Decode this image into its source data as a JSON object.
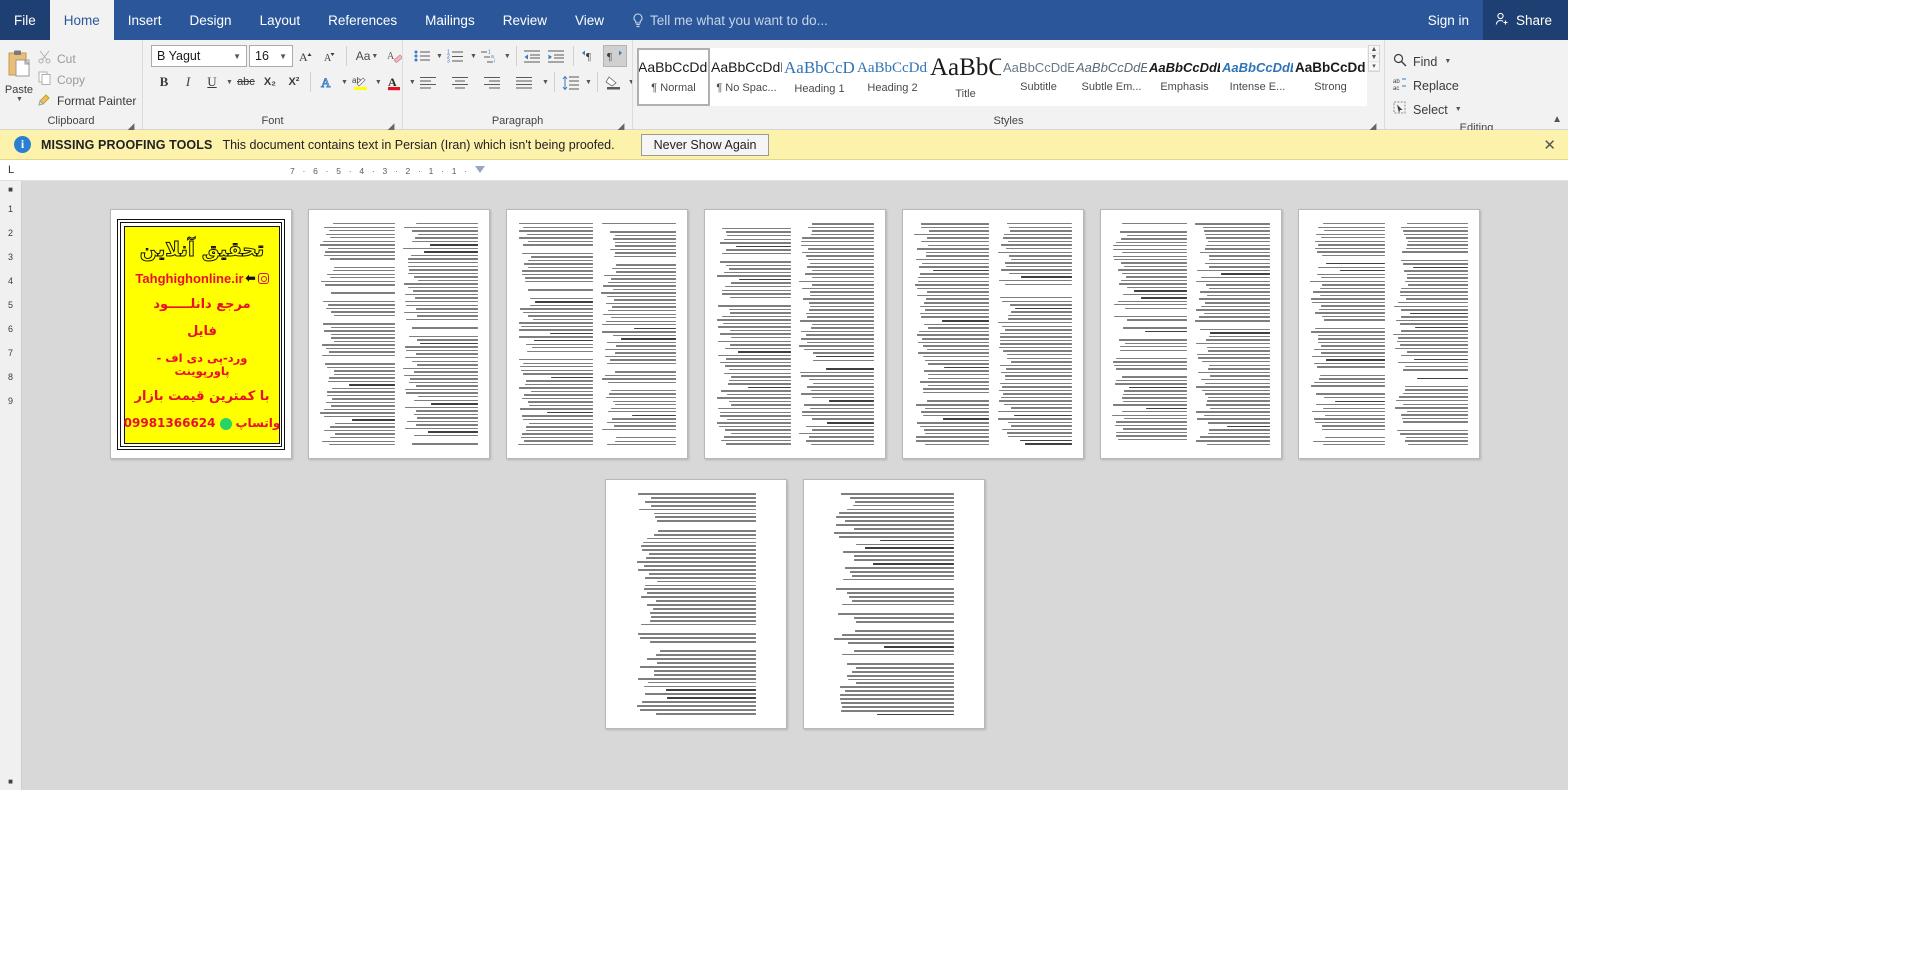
{
  "app": {
    "name": "Microsoft Word",
    "accent_color": "#2b579a",
    "file_tab_color": "#1e3f72"
  },
  "tabs": [
    {
      "label": "File",
      "active": false,
      "kind": "file"
    },
    {
      "label": "Home",
      "active": true,
      "kind": "normal"
    },
    {
      "label": "Insert",
      "active": false,
      "kind": "normal"
    },
    {
      "label": "Design",
      "active": false,
      "kind": "normal"
    },
    {
      "label": "Layout",
      "active": false,
      "kind": "normal"
    },
    {
      "label": "References",
      "active": false,
      "kind": "normal"
    },
    {
      "label": "Mailings",
      "active": false,
      "kind": "normal"
    },
    {
      "label": "Review",
      "active": false,
      "kind": "normal"
    },
    {
      "label": "View",
      "active": false,
      "kind": "normal"
    }
  ],
  "tellme": {
    "label": "Tell me what you want to do...",
    "icon": "lightbulb-icon"
  },
  "account": {
    "signin_label": "Sign in",
    "share_label": "Share",
    "share_icon": "person-add-icon"
  },
  "ribbon": {
    "groups": [
      {
        "name": "Clipboard",
        "label": "Clipboard",
        "has_dialog_launcher": true
      },
      {
        "name": "Font",
        "label": "Font",
        "has_dialog_launcher": true
      },
      {
        "name": "Paragraph",
        "label": "Paragraph",
        "has_dialog_launcher": true
      },
      {
        "name": "Styles",
        "label": "Styles",
        "has_dialog_launcher": true
      },
      {
        "name": "Editing",
        "label": "Editing",
        "has_dialog_launcher": false
      }
    ],
    "clipboard": {
      "paste_label": "Paste",
      "paste_icon": "clipboard-icon",
      "cut_label": "Cut",
      "cut_icon": "scissors-icon",
      "copy_label": "Copy",
      "copy_icon": "copy-icon",
      "format_painter_label": "Format Painter",
      "format_painter_icon": "paintbrush-icon"
    },
    "font": {
      "font_name": "B Yagut",
      "font_size": "16",
      "bold": "B",
      "italic": "I",
      "underline": "U",
      "strikethrough": "abc",
      "subscript": "X₂",
      "superscript": "X²",
      "text_effects_icon": "text-effects-icon",
      "highlight_icon": "highlight-color-icon",
      "highlight_color": "#ffff00",
      "font_color_icon": "font-color-icon",
      "font_color": "#e81123",
      "grow_font": "A",
      "shrink_font": "A",
      "change_case": "Aa",
      "clear_formatting_icon": "clear-formatting-icon"
    },
    "paragraph": {
      "bullets_icon": "bullet-list-icon",
      "numbering_icon": "numbered-list-icon",
      "multilevel_icon": "multilevel-list-icon",
      "decrease_indent_icon": "decrease-indent-icon",
      "increase_indent_icon": "increase-indent-icon",
      "ltr_icon": "left-to-right-icon",
      "rtl_icon": "right-to-left-icon",
      "rtl_active": true,
      "sort_icon": "sort-az-icon",
      "show_marks_icon": "pilcrow-icon",
      "align_left_icon": "align-left-icon",
      "align_center_icon": "align-center-icon",
      "align_right_icon": "align-right-icon",
      "justify_icon": "justify-icon",
      "line_spacing_icon": "line-spacing-icon",
      "shading_icon": "shading-icon",
      "borders_icon": "borders-icon"
    },
    "styles": [
      {
        "preview": "AaBbCcDdEe",
        "name": "¶ Normal",
        "selected": true,
        "style": "normal"
      },
      {
        "preview": "AaBbCcDdEe",
        "name": "¶ No Spac...",
        "selected": false,
        "style": "normal"
      },
      {
        "preview": "AaBbCcDdEe",
        "name": "Heading 1",
        "selected": false,
        "style": "heading1"
      },
      {
        "preview": "AaBbCcDdEe",
        "name": "Heading 2",
        "selected": false,
        "style": "heading2"
      },
      {
        "preview": "AaBbCcDdEe",
        "name": "Title",
        "selected": false,
        "style": "title"
      },
      {
        "preview": "AaBbCcDdEe",
        "name": "Subtitle",
        "selected": false,
        "style": "subtitle"
      },
      {
        "preview": "AaBbCcDdEe",
        "name": "Subtle Em...",
        "selected": false,
        "style": "subtle-em"
      },
      {
        "preview": "AaBbCcDdEe",
        "name": "Emphasis",
        "selected": false,
        "style": "emphasis"
      },
      {
        "preview": "AaBbCcDdEe",
        "name": "Intense E...",
        "selected": false,
        "style": "intense-em"
      },
      {
        "preview": "AaBbCcDdEe",
        "name": "Strong",
        "selected": false,
        "style": "strong"
      }
    ],
    "editing": {
      "find_label": "Find",
      "find_icon": "magnifier-icon",
      "replace_label": "Replace",
      "replace_icon": "replace-icon",
      "select_label": "Select",
      "select_icon": "select-icon"
    },
    "collapse_icon": "chevron-up-icon"
  },
  "message_bar": {
    "icon": "info-icon",
    "title": "MISSING PROOFING TOOLS",
    "text": "This document contains text in Persian (Iran) which isn't being proofed.",
    "button_label": "Never Show Again",
    "close_icon": "close-icon",
    "background": "#fdf2ab"
  },
  "ruler": {
    "tab_stop_marker": "L",
    "ticks": [
      "7",
      "6",
      "5",
      "4",
      "3",
      "2",
      "1",
      "1"
    ]
  },
  "document": {
    "scroll_row_numbers": [
      "1",
      "2",
      "3",
      "4",
      "5",
      "6",
      "7",
      "8",
      "9"
    ],
    "page_count": 9,
    "pages": [
      {
        "index": 1,
        "kind": "ad-banner"
      },
      {
        "index": 2,
        "kind": "text",
        "columns": 2
      },
      {
        "index": 3,
        "kind": "text",
        "columns": 2
      },
      {
        "index": 4,
        "kind": "text",
        "columns": 2
      },
      {
        "index": 5,
        "kind": "text",
        "columns": 2
      },
      {
        "index": 6,
        "kind": "text",
        "columns": 2
      },
      {
        "index": 7,
        "kind": "text",
        "columns": 2
      },
      {
        "index": 8,
        "kind": "text",
        "columns": 1
      },
      {
        "index": 9,
        "kind": "text",
        "columns": 1
      }
    ]
  },
  "ad": {
    "title": "تحقیق آنلاین",
    "url": "Tahghighonline.ir",
    "url_arrow_icon": "left-arrow-icon",
    "instagram_icon": "instagram-icon",
    "line1": "مرجع دانلـــــود",
    "line2": "فایل",
    "line3": "ورد-پی دی اف - پاورپوینت",
    "line4": "با کمترین قیمت بازار",
    "phone": "09981366624",
    "whatsapp_label": "واتساپ",
    "whatsapp_icon": "whatsapp-icon",
    "background_color": "#ffff00",
    "text_color": "#e8102a"
  }
}
